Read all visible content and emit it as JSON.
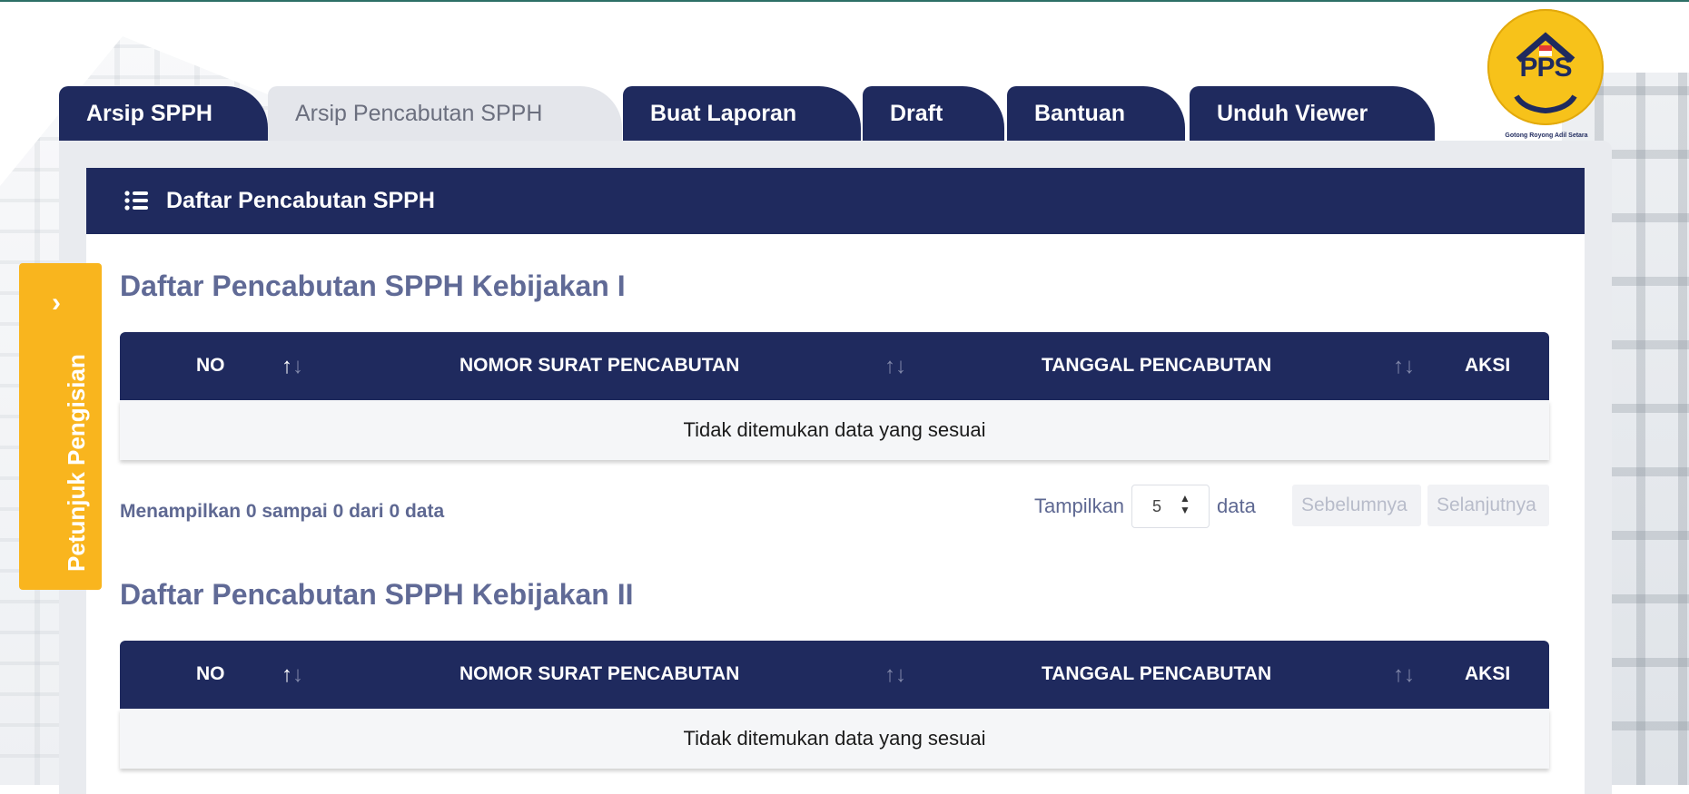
{
  "tabs": [
    {
      "label": "Arsip SPPH",
      "active": true
    },
    {
      "label": "Arsip Pencabutan SPPH",
      "active": false
    },
    {
      "label": "Buat Laporan",
      "active": true
    },
    {
      "label": "Draft",
      "active": true
    },
    {
      "label": "Bantuan",
      "active": true
    },
    {
      "label": "Unduh Viewer",
      "active": true
    }
  ],
  "logo": {
    "text": "PPS",
    "subtitle": "Gotong Royong   Adil   Setara"
  },
  "card": {
    "title": "Daftar Pencabutan SPPH",
    "icon": "list-icon"
  },
  "side_tab": {
    "label": "Petunjuk Pengisian",
    "icon": "chevron-right-icon"
  },
  "sections": [
    {
      "title": "Daftar Pencabutan SPPH Kebijakan I",
      "columns": [
        "NO",
        "NOMOR SURAT PENCABUTAN",
        "TANGGAL PENCABUTAN",
        "AKSI"
      ],
      "empty_message": "Tidak ditemukan data yang sesuai",
      "info": "Menampilkan 0 sampai 0 dari 0 data",
      "page_size_label": "Tampilkan",
      "page_size": "5",
      "page_size_suffix": "data",
      "prev_label": "Sebelumnya",
      "next_label": "Selanjutnya"
    },
    {
      "title": "Daftar Pencabutan SPPH Kebijakan II",
      "columns": [
        "NO",
        "NOMOR SURAT PENCABUTAN",
        "TANGGAL PENCABUTAN",
        "AKSI"
      ],
      "empty_message": "Tidak ditemukan data yang sesuai"
    }
  ],
  "colors": {
    "navy": "#1f2a5e",
    "accent": "#f9b51e",
    "muted_text": "#606a96"
  }
}
